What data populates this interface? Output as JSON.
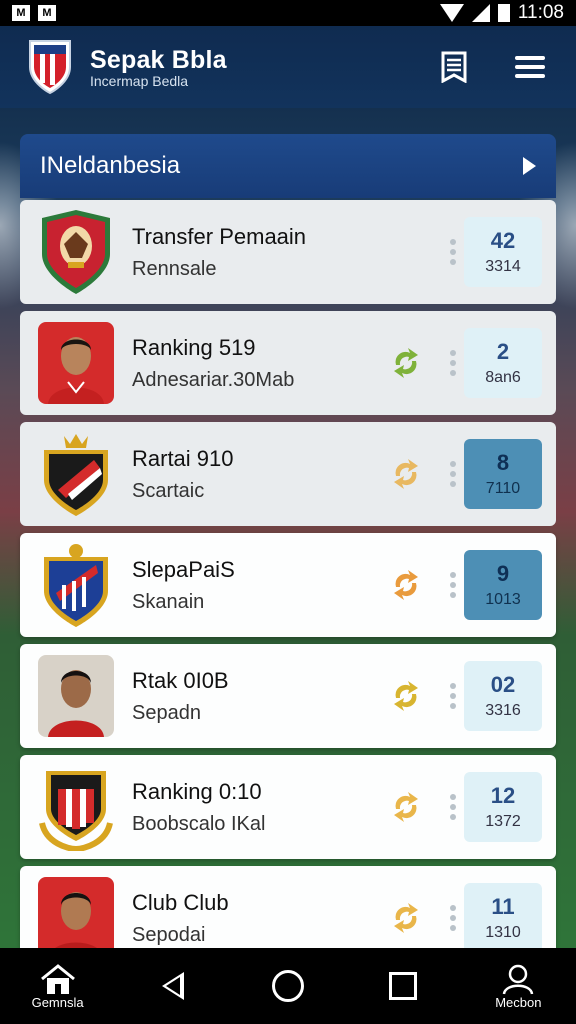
{
  "status_bar": {
    "time": "11:08"
  },
  "header": {
    "title": "Sepak Bbla",
    "subtitle": "Incermap Bedla"
  },
  "section": {
    "title": "INeldanbesia"
  },
  "rows": [
    {
      "name": "Transfer Pemaain",
      "detail": "Rennsale",
      "score_top": "42",
      "score_bottom": "3314",
      "swap_color": "",
      "card": "grey",
      "score_style": "light",
      "avatar": "badge-eagle"
    },
    {
      "name": "Ranking 519",
      "detail": "Adnesariar.30Mab",
      "score_top": "2",
      "score_bottom": "8an6",
      "swap_color": "#7fb23a",
      "card": "grey",
      "score_style": "light",
      "avatar": "player-photo"
    },
    {
      "name": "Rartai 910",
      "detail": "Scartaic",
      "score_top": "8",
      "score_bottom": "7110",
      "swap_color": "#e8b860",
      "card": "grey",
      "score_style": "dark",
      "avatar": "badge-crown"
    },
    {
      "name": "SlepaPaiS",
      "detail": "Skanain",
      "score_top": "9",
      "score_bottom": "1013",
      "swap_color": "#e99b3d",
      "card": "white",
      "score_style": "dark",
      "avatar": "badge-blue"
    },
    {
      "name": "Rtak 0I0B",
      "detail": "Sepadn",
      "score_top": "02",
      "score_bottom": "3316",
      "swap_color": "#d8b530",
      "card": "white",
      "score_style": "light",
      "avatar": "player-photo-2"
    },
    {
      "name": "Ranking 0:10",
      "detail": "Boobscalo IKal",
      "score_top": "12",
      "score_bottom": "1372",
      "swap_color": "#e9b64a",
      "card": "white",
      "score_style": "light",
      "avatar": "badge-wreath"
    },
    {
      "name": "Club Club",
      "detail": "Sepodai",
      "score_top": "11",
      "score_bottom": "1310",
      "swap_color": "#e9b64a",
      "card": "white",
      "score_style": "light",
      "avatar": "player-photo-3"
    }
  ],
  "nav": {
    "home_label": "Gemnsla",
    "profile_label": "Mecbon"
  },
  "colors": {
    "header": "#12335c",
    "section": "#1f4a8c",
    "score_dark": "#4d8fb5",
    "score_light": "#dff1f7"
  }
}
